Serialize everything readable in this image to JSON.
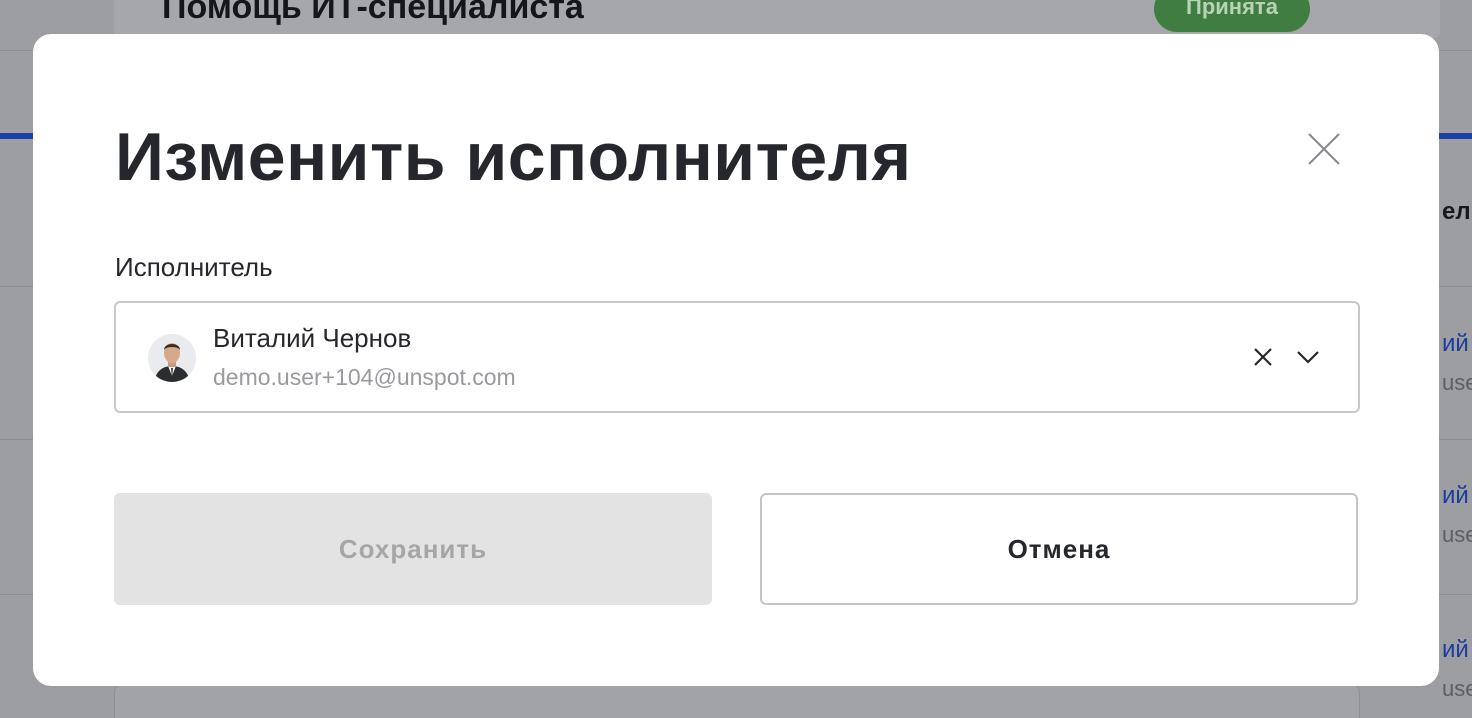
{
  "background": {
    "card_title": "Помощь ИТ-специалиста",
    "status_badge": "Принята",
    "side_fragments": [
      "ел",
      "ий",
      "use",
      "ий",
      "use",
      "ий",
      "use"
    ]
  },
  "modal": {
    "title": "Изменить исполнителя",
    "close_icon": "close-icon",
    "field_label": "Исполнитель",
    "selected_user": {
      "name": "Виталий Чернов",
      "email": "demo.user+104@unspot.com"
    },
    "clear_icon": "clear-icon",
    "dropdown_icon": "chevron-down-icon",
    "save_label": "Сохранить",
    "cancel_label": "Отмена"
  },
  "colors": {
    "overlay": "#9d9ea2",
    "accent_blue": "#1a3fa6",
    "badge_green": "#3f7d42",
    "text_dark": "#26272d",
    "disabled_button": "#e3e3e3"
  }
}
